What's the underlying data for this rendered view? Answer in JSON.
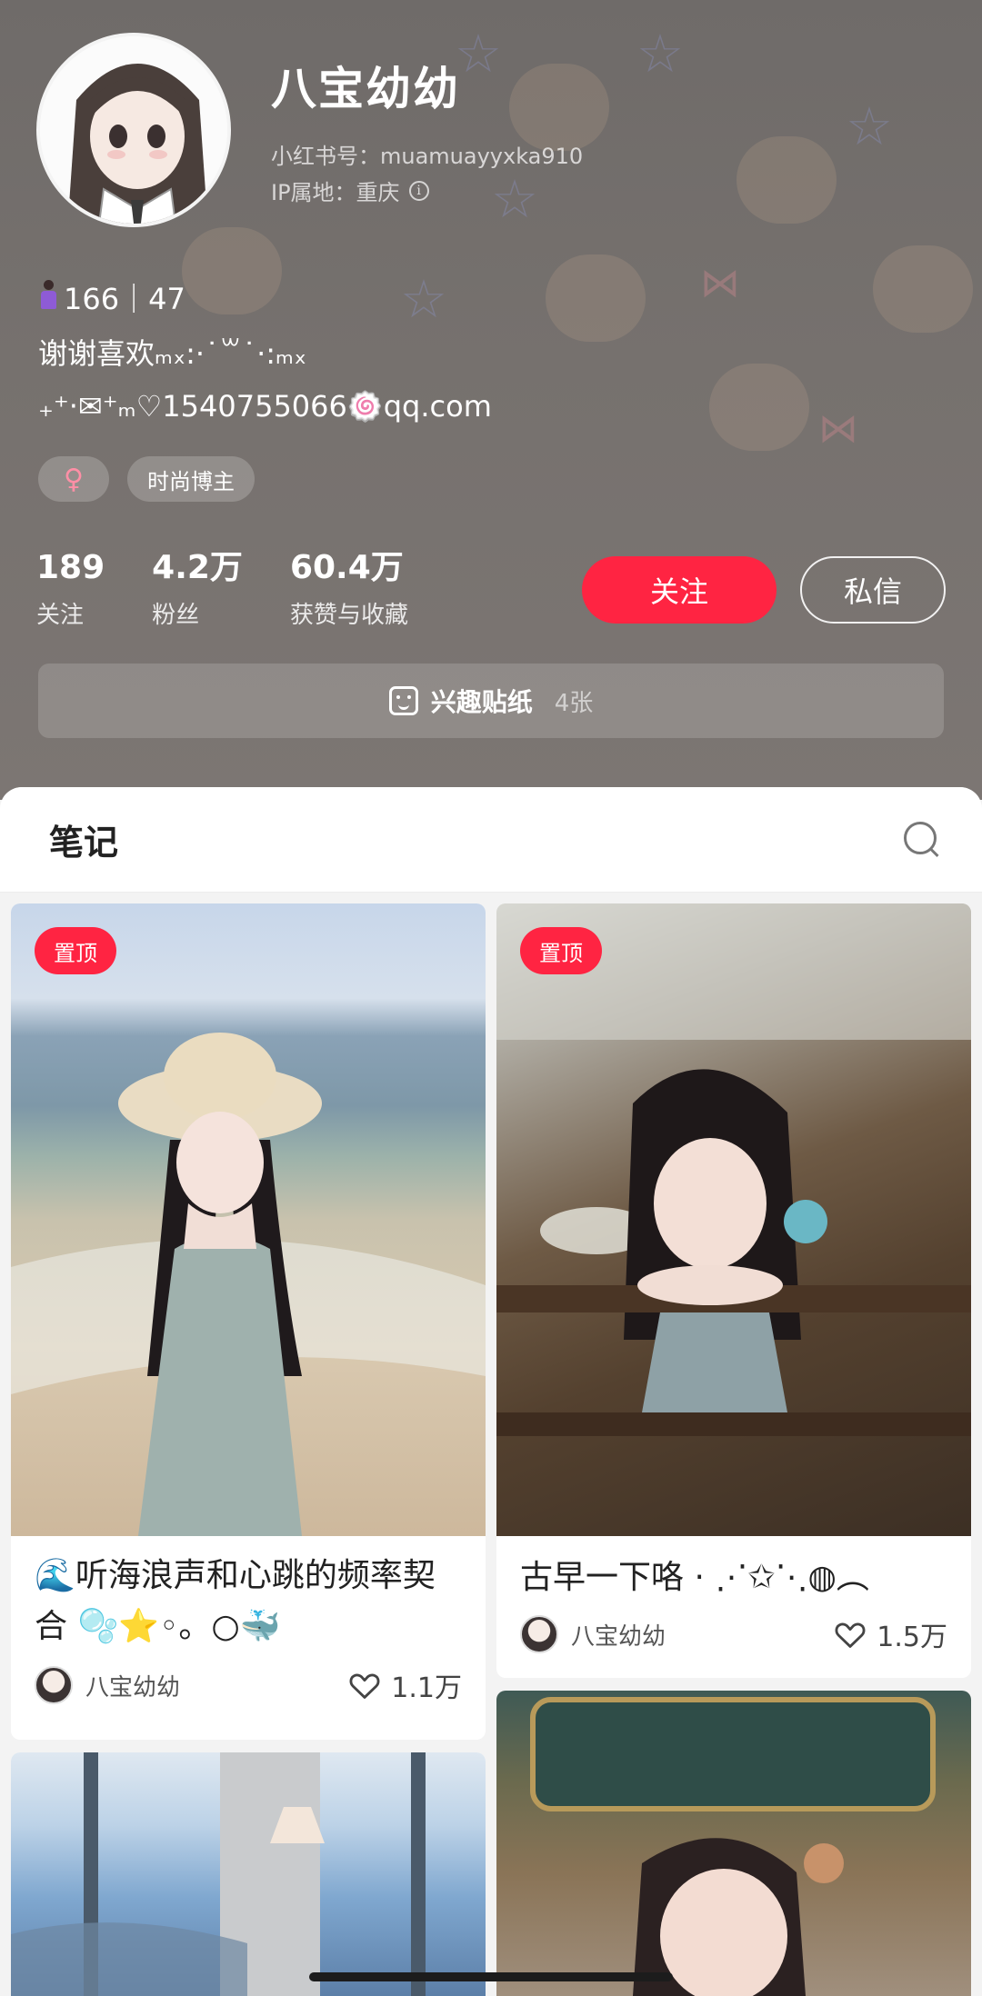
{
  "profile": {
    "name": "八宝幼幼",
    "red_id": "小红书号：muamuayyxka910",
    "ip_location": "IP属地：重庆",
    "bio_line1": "166｜47",
    "bio_line2": "谢谢喜欢ₘₓ:·˙꒳˙·:ₘₓ",
    "bio_line3": "₊⁺‧✉︎⁺ₘ♡1540755066🍥qq.com",
    "tags": [
      "♀",
      "时尚博主"
    ],
    "stats": [
      {
        "value": "189",
        "label": "关注"
      },
      {
        "value": "4.2万",
        "label": "粉丝"
      },
      {
        "value": "60.4万",
        "label": "获赞与收藏"
      }
    ],
    "follow_label": "关注",
    "message_label": "私信",
    "sticker_label": "兴趣贴纸",
    "sticker_count": "4张"
  },
  "notes": {
    "section_title": "笔记",
    "cards": [
      {
        "pinned": "置顶",
        "title": "🌊听海浪声和心跳的频率契合 🫧⭐️◦。○🐳",
        "author": "八宝幼幼",
        "likes": "1.1万"
      },
      {
        "pinned": "置顶",
        "title": "古早一下咯 · ⋰✩⋱◍︵",
        "author": "八宝幼幼",
        "likes": "1.5万"
      }
    ]
  },
  "colors": {
    "accent": "#ff2442",
    "header_bg": "#76716e"
  }
}
